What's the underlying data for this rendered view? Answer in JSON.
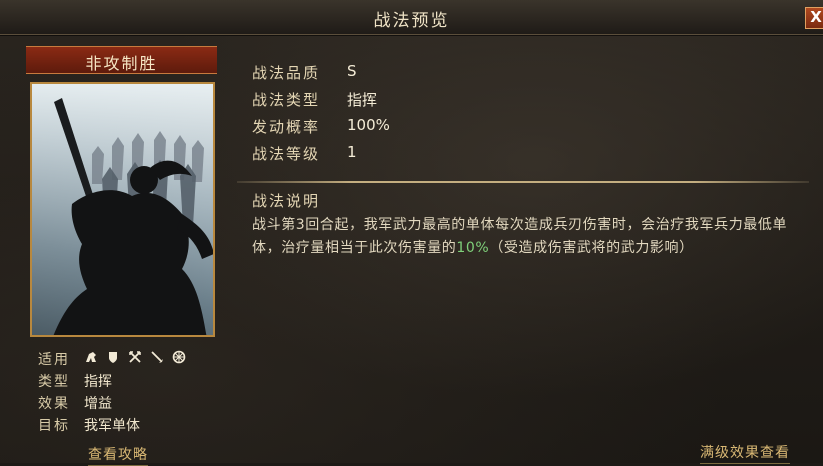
{
  "window": {
    "title": "战法预览",
    "close_label": "X"
  },
  "skill": {
    "name": "非攻制胜",
    "applicable_label": "适用",
    "applicable_icons": [
      "cavalry-icon",
      "shield-icon",
      "crossed-bows-icon",
      "spear-icon",
      "wheel-icon"
    ],
    "type_label": "类型",
    "type_value": "指挥",
    "effect_label": "效果",
    "effect_value": "增益",
    "target_label": "目标",
    "target_value": "我军单体",
    "guide_link": "查看攻略"
  },
  "attributes": [
    {
      "label": "战法品质",
      "value": "S"
    },
    {
      "label": "战法类型",
      "value": "指挥"
    },
    {
      "label": "发动概率",
      "value": "100%"
    },
    {
      "label": "战法等级",
      "value": "1"
    }
  ],
  "description": {
    "title": "战法说明",
    "text_before": "战斗第3回合起，我军武力最高的单体每次造成兵刃伤害时，会治疗我军兵力最低单体，治疗量相当于此次伤害量的",
    "highlight": "10%",
    "text_after": "（受造成伤害武将的武力影响）"
  },
  "full_level_link": "满级效果查看",
  "colors": {
    "highlight": "#7fd07a",
    "link": "#d9b874",
    "banner": "#8a2a14"
  }
}
